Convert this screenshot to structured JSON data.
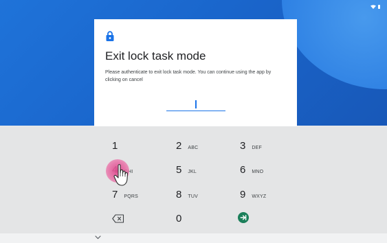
{
  "dialog": {
    "title": "Exit lock task mode",
    "message": "Please authenticate to exit lock task mode. You can continue using the app by clicking on cancel",
    "icon": "lock-icon"
  },
  "keypad": {
    "keys": [
      {
        "digit": "1",
        "letters": ""
      },
      {
        "digit": "2",
        "letters": "ABC"
      },
      {
        "digit": "3",
        "letters": "DEF"
      },
      {
        "digit": "4",
        "letters": "GHI"
      },
      {
        "digit": "5",
        "letters": "JKL"
      },
      {
        "digit": "6",
        "letters": "MNO"
      },
      {
        "digit": "7",
        "letters": "PQRS"
      },
      {
        "digit": "8",
        "letters": "TUV"
      },
      {
        "digit": "9",
        "letters": "WXYZ"
      },
      {
        "digit": "0",
        "letters": ""
      }
    ],
    "delete_icon": "backspace-icon",
    "enter_icon": "enter-arrow-icon"
  },
  "colors": {
    "background_blue": "#1a66cc",
    "accent": "#1a73e8",
    "enter_key": "#1b7f5a",
    "touch_indicator": "#de468c"
  },
  "navigation": {
    "collapse_icon": "chevron-down-icon"
  }
}
